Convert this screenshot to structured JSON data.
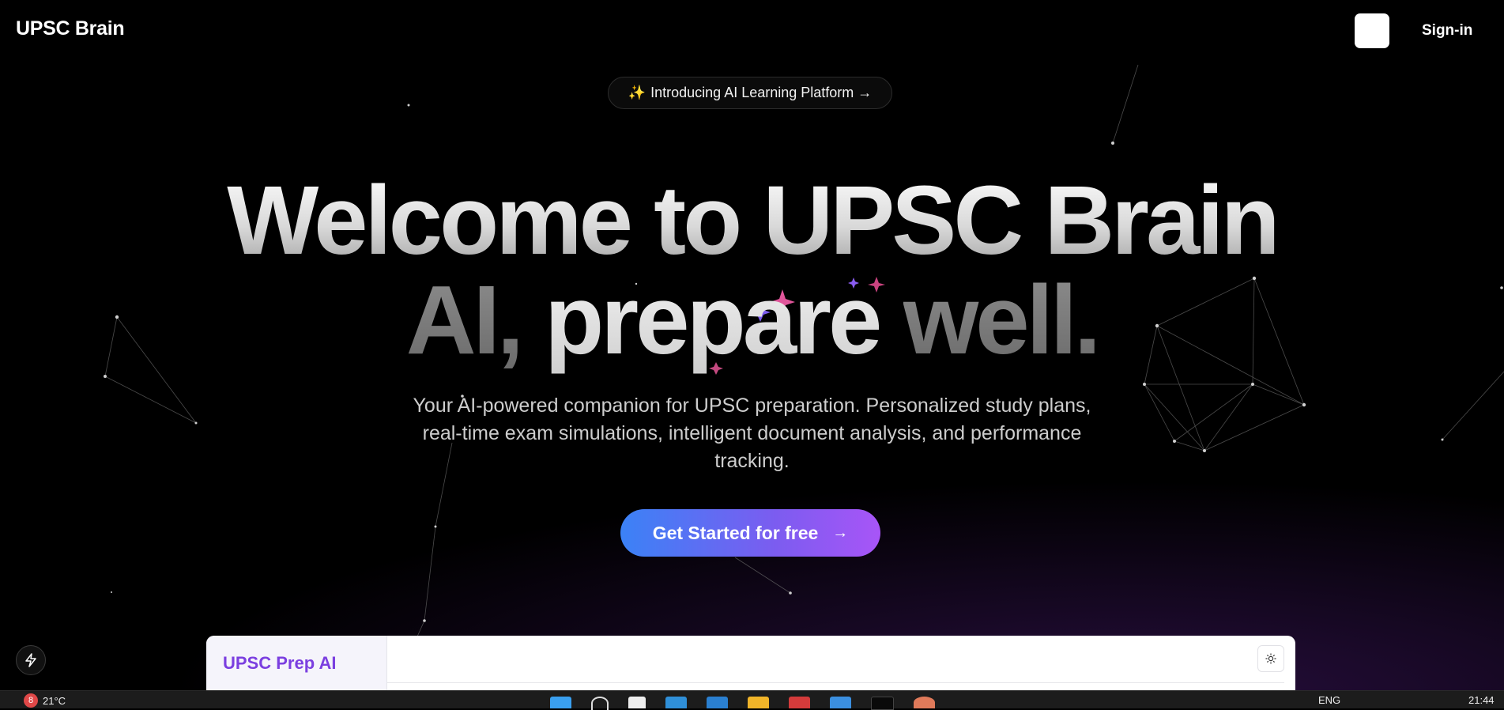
{
  "nav": {
    "logo": "UPSC Brain",
    "signin_label": "Sign-in"
  },
  "hero": {
    "pill_label": "Introducing AI Learning Platform →",
    "title_line1": "Welcome to UPSC Brain",
    "title_line2_part1": "AI,",
    "title_line2_part2": "prepare",
    "title_line2_part3": "well.",
    "subtitle": "Your AI-powered companion for UPSC preparation. Personalized study plans, real-time exam simulations, intelligent document analysis, and performance tracking.",
    "cta_label": "Get Started for free"
  },
  "preview": {
    "title": "UPSC Prep AI"
  },
  "taskbar": {
    "notification_count": "8",
    "temperature": "21°C",
    "language": "ENG",
    "time": "21:44"
  },
  "icons": {
    "pill": "sparkles-icon",
    "cta": "arrow-right-icon",
    "floating": "bolt-icon",
    "preview_toggle": "sun-icon"
  },
  "colors": {
    "background": "#000000",
    "cta_start": "#3b82f6",
    "cta_end": "#a855f7",
    "preview_title": "#7b3fe0"
  }
}
